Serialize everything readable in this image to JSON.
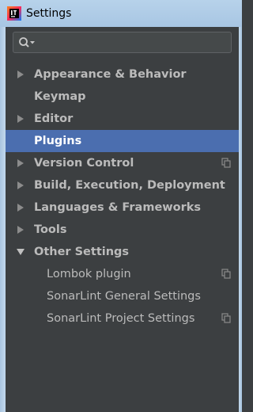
{
  "window": {
    "title": "Settings",
    "app_icon": "intellij-idea-icon"
  },
  "search": {
    "value": "",
    "placeholder": "",
    "icon": "search-icon"
  },
  "tree": {
    "items": [
      {
        "label": "Appearance & Behavior",
        "level": 0,
        "expandable": true,
        "expanded": false,
        "selected": false,
        "project_icon": false
      },
      {
        "label": "Keymap",
        "level": 0,
        "expandable": false,
        "expanded": false,
        "selected": false,
        "project_icon": false
      },
      {
        "label": "Editor",
        "level": 0,
        "expandable": true,
        "expanded": false,
        "selected": false,
        "project_icon": false
      },
      {
        "label": "Plugins",
        "level": 0,
        "expandable": false,
        "expanded": false,
        "selected": true,
        "project_icon": false
      },
      {
        "label": "Version Control",
        "level": 0,
        "expandable": true,
        "expanded": false,
        "selected": false,
        "project_icon": true
      },
      {
        "label": "Build, Execution, Deployment",
        "level": 0,
        "expandable": true,
        "expanded": false,
        "selected": false,
        "project_icon": false
      },
      {
        "label": "Languages & Frameworks",
        "level": 0,
        "expandable": true,
        "expanded": false,
        "selected": false,
        "project_icon": false
      },
      {
        "label": "Tools",
        "level": 0,
        "expandable": true,
        "expanded": false,
        "selected": false,
        "project_icon": false
      },
      {
        "label": "Other Settings",
        "level": 0,
        "expandable": true,
        "expanded": true,
        "selected": false,
        "project_icon": false
      },
      {
        "label": "Lombok plugin",
        "level": 1,
        "expandable": false,
        "expanded": false,
        "selected": false,
        "project_icon": true
      },
      {
        "label": "SonarLint General Settings",
        "level": 1,
        "expandable": false,
        "expanded": false,
        "selected": false,
        "project_icon": false
      },
      {
        "label": "SonarLint Project Settings",
        "level": 1,
        "expandable": false,
        "expanded": false,
        "selected": false,
        "project_icon": true
      }
    ]
  },
  "colors": {
    "panel_bg": "#3c3f41",
    "selection": "#4b6eaf",
    "text": "#bbbbbb",
    "selected_text": "#ffffff"
  }
}
